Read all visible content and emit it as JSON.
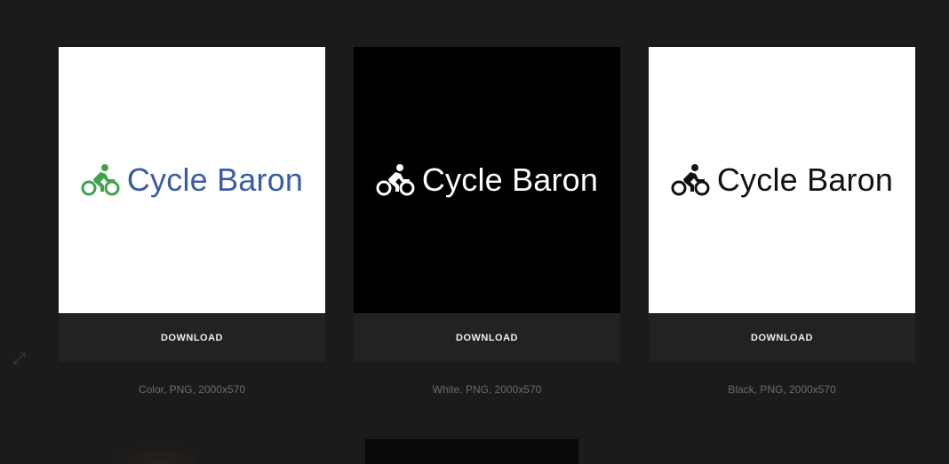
{
  "cards": [
    {
      "variant": "color",
      "wordmark": "Cycle Baron",
      "download_label": "DOWNLOAD",
      "caption": "Color, PNG, 2000x570",
      "bg": "#ffffff",
      "text_color": "#3a5ba6",
      "icon_color": "#3fa34d"
    },
    {
      "variant": "white",
      "wordmark": "Cycle Baron",
      "download_label": "DOWNLOAD",
      "caption": "White, PNG, 2000x570",
      "bg": "#000000",
      "text_color": "#ffffff",
      "icon_color": "#ffffff"
    },
    {
      "variant": "black",
      "wordmark": "Cycle Baron",
      "download_label": "DOWNLOAD",
      "caption": "Black, PNG, 2000x570",
      "bg": "#ffffff",
      "text_color": "#111111",
      "icon_color": "#111111"
    }
  ],
  "icons": {
    "expand": "expand-arrows-icon",
    "logo": "cyclist-icon"
  }
}
